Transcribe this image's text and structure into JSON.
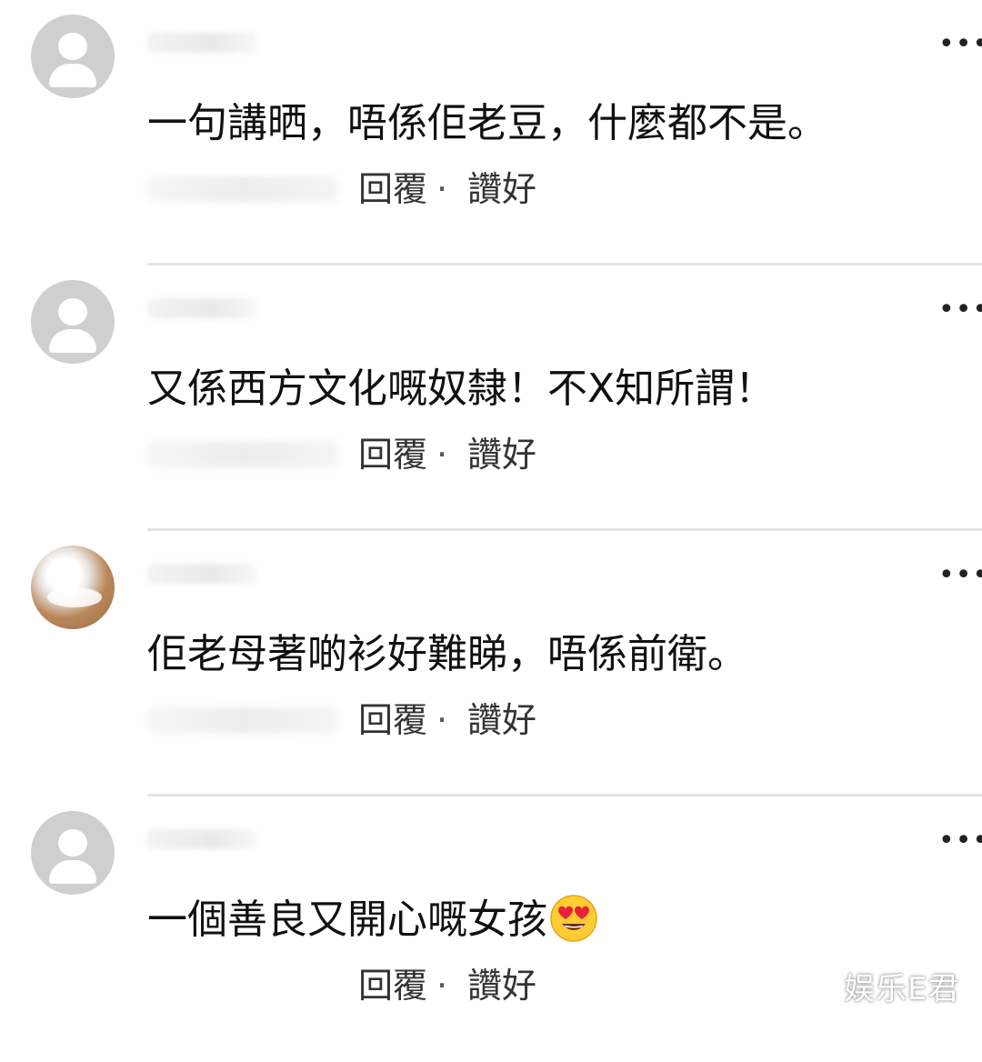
{
  "comments": [
    {
      "text": "一句講晒，唔係佢老豆，什麼都不是。",
      "reply_label": "回覆",
      "like_label": "讚好",
      "separator": "·",
      "more_icon": "more-horizontal-icon",
      "avatar_type": "default-user-icon"
    },
    {
      "text": "又係西方文化嘅奴隸！不X知所謂！",
      "reply_label": "回覆",
      "like_label": "讚好",
      "separator": "·",
      "more_icon": "more-horizontal-icon",
      "avatar_type": "default-user-icon"
    },
    {
      "text": "佢老母著啲衫好難睇，唔係前衛。",
      "reply_label": "回覆",
      "like_label": "讚好",
      "separator": "·",
      "more_icon": "more-horizontal-icon",
      "avatar_type": "photo"
    },
    {
      "text": "一個善良又開心嘅女孩",
      "emoji": "heart-eyes-emoji",
      "reply_label": "回覆",
      "like_label": "讚好",
      "separator": "·",
      "more_icon": "more-horizontal-icon",
      "avatar_type": "default-user-icon"
    }
  ],
  "more_glyph": "•••",
  "watermark": "娱乐E君",
  "colors": {
    "background": "#ffffff",
    "text": "#111111",
    "meta_text": "#333333",
    "divider": "#e4e4e4",
    "avatar_placeholder": "#cfcfcf"
  }
}
